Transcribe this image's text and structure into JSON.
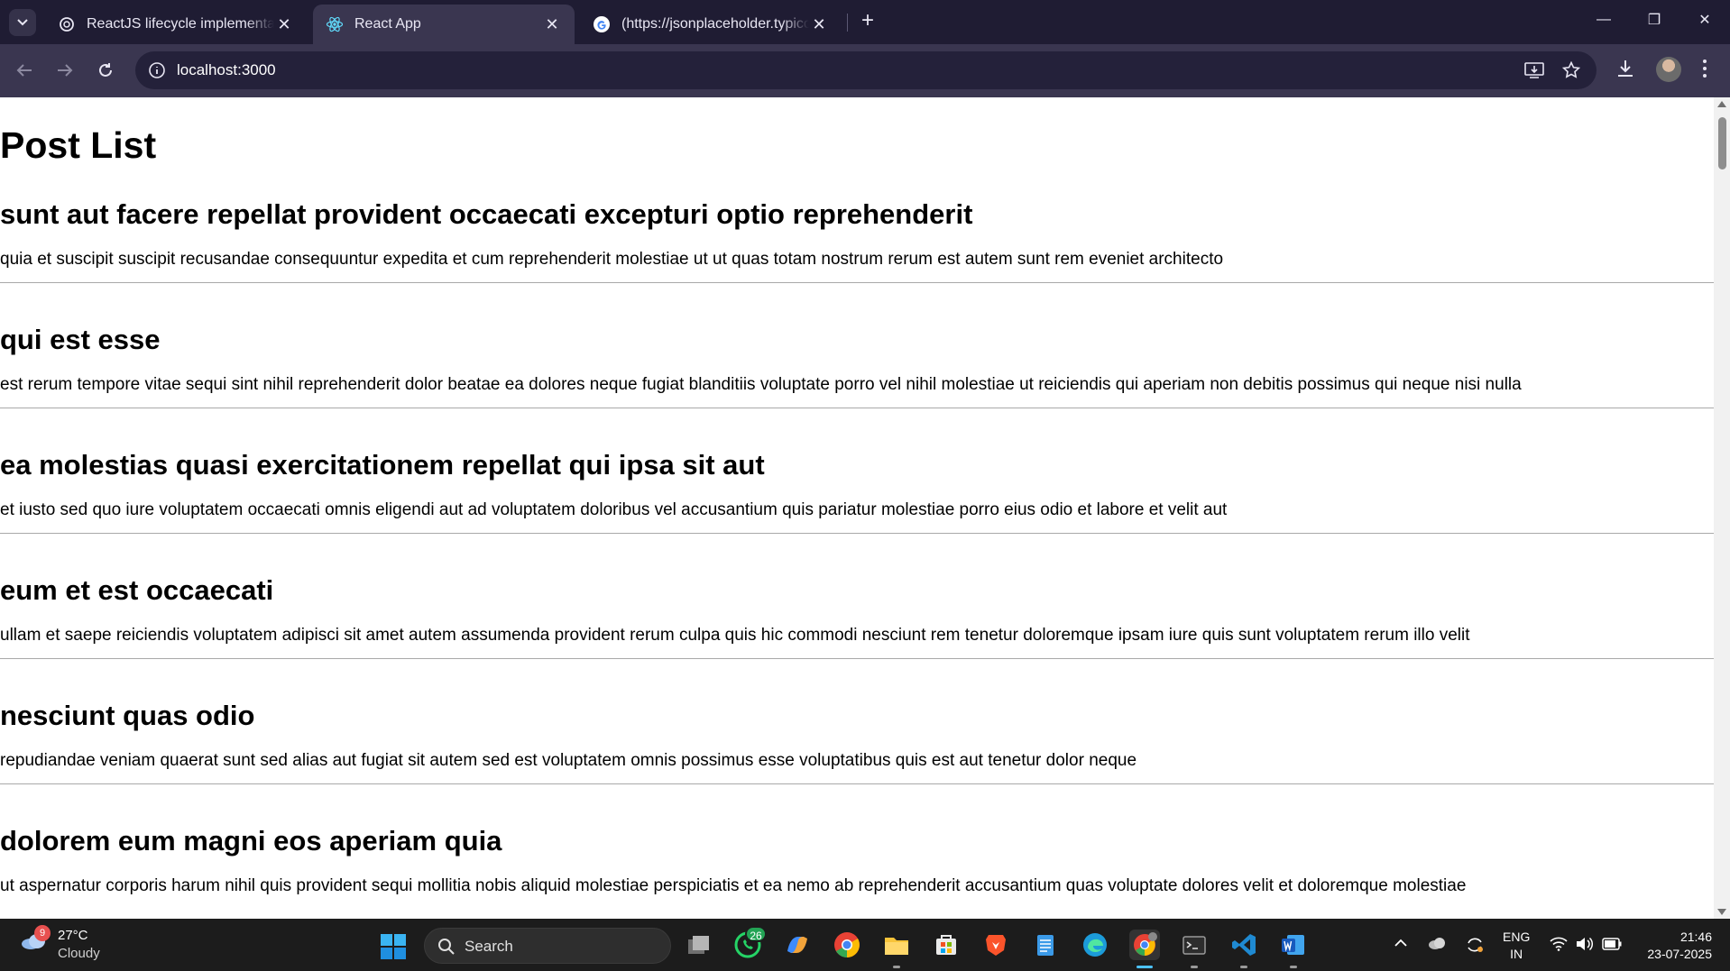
{
  "browser": {
    "tabs": [
      {
        "title": "ReactJS lifecycle implementatio",
        "close": "✕"
      },
      {
        "title": "React App",
        "close": "✕"
      },
      {
        "title": "(https://jsonplaceholder.typicod",
        "close": "✕"
      }
    ],
    "new_tab": "+",
    "url": "localhost:3000",
    "window_controls": {
      "minimize": "—",
      "restore": "❐",
      "close": "✕"
    }
  },
  "page": {
    "heading": "Post List",
    "posts": [
      {
        "title": "sunt aut facere repellat provident occaecati excepturi optio reprehenderit",
        "body": "quia et suscipit suscipit recusandae consequuntur expedita et cum reprehenderit molestiae ut ut quas totam nostrum rerum est autem sunt rem eveniet architecto"
      },
      {
        "title": "qui est esse",
        "body": "est rerum tempore vitae sequi sint nihil reprehenderit dolor beatae ea dolores neque fugiat blanditiis voluptate porro vel nihil molestiae ut reiciendis qui aperiam non debitis possimus qui neque nisi nulla"
      },
      {
        "title": "ea molestias quasi exercitationem repellat qui ipsa sit aut",
        "body": "et iusto sed quo iure voluptatem occaecati omnis eligendi aut ad voluptatem doloribus vel accusantium quis pariatur molestiae porro eius odio et labore et velit aut"
      },
      {
        "title": "eum et est occaecati",
        "body": "ullam et saepe reiciendis voluptatem adipisci sit amet autem assumenda provident rerum culpa quis hic commodi nesciunt rem tenetur doloremque ipsam iure quis sunt voluptatem rerum illo velit"
      },
      {
        "title": "nesciunt quas odio",
        "body": "repudiandae veniam quaerat sunt sed alias aut fugiat sit autem sed est voluptatem omnis possimus esse voluptatibus quis est aut tenetur dolor neque"
      },
      {
        "title": "dolorem eum magni eos aperiam quia",
        "body": "ut aspernatur corporis harum nihil quis provident sequi mollitia nobis aliquid molestiae perspiciatis et ea nemo ab reprehenderit accusantium quas voluptate dolores velit et doloremque molestiae"
      }
    ]
  },
  "taskbar": {
    "weather": {
      "badge": "9",
      "temp": "27°C",
      "condition": "Cloudy"
    },
    "search_label": "Search",
    "whatsapp_badge": "26",
    "language": {
      "line1": "ENG",
      "line2": "IN"
    },
    "clock": {
      "time": "21:46",
      "date": "23-07-2025"
    }
  },
  "colors": {
    "tabstrip": "#1f1c33",
    "toolbar": "#3a3650",
    "taskbar": "#1c1c1c",
    "accent": "#4cc2ff"
  }
}
